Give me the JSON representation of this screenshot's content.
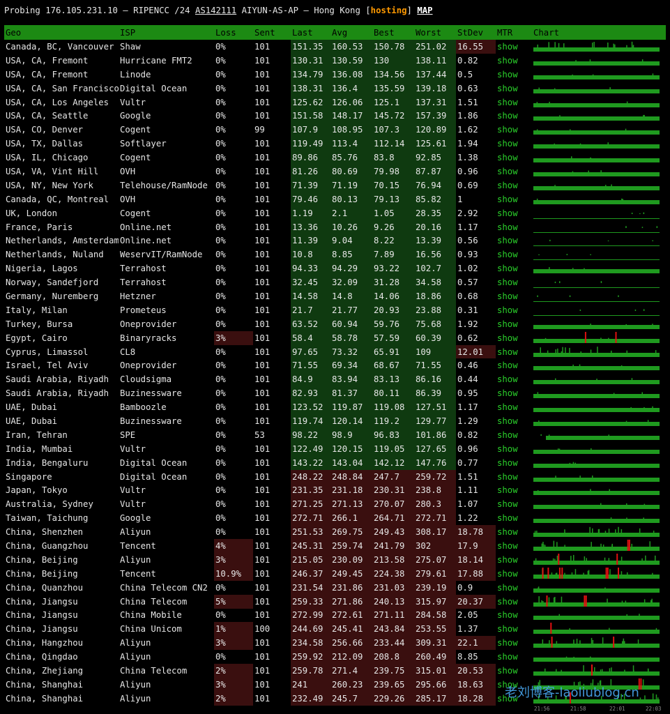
{
  "header": {
    "text_a": "Probing 176.105.231.10 – RIPENCC /24 ",
    "asn": "AS142111",
    "text_b": " AIYUN-AS-AP – Hong Kong ",
    "tag": "hosting",
    "map_link": "MAP"
  },
  "columns": [
    "Geo",
    "ISP",
    "Loss",
    "Sent",
    "Last",
    "Avg",
    "Best",
    "Worst",
    "StDev",
    "MTR",
    "Chart"
  ],
  "rows": [
    {
      "geo": "Canada, BC, Vancouver",
      "isp": "Shaw",
      "loss": "0%",
      "sent": "101",
      "last": "151.35",
      "avg": "160.53",
      "best": "150.78",
      "worst": "251.02",
      "stdev": "16.55",
      "mtr": "show"
    },
    {
      "geo": "USA, CA, Fremont",
      "isp": "Hurricane FMT2",
      "loss": "0%",
      "sent": "101",
      "last": "130.31",
      "avg": "130.59",
      "best": "130",
      "worst": "138.11",
      "stdev": "0.82",
      "mtr": "show"
    },
    {
      "geo": "USA, CA, Fremont",
      "isp": "Linode",
      "loss": "0%",
      "sent": "101",
      "last": "134.79",
      "avg": "136.08",
      "best": "134.56",
      "worst": "137.44",
      "stdev": "0.5",
      "mtr": "show"
    },
    {
      "geo": "USA, CA, San Francisco",
      "isp": "Digital Ocean",
      "loss": "0%",
      "sent": "101",
      "last": "138.31",
      "avg": "136.4",
      "best": "135.59",
      "worst": "139.18",
      "stdev": "0.63",
      "mtr": "show"
    },
    {
      "geo": "USA, CA, Los Angeles",
      "isp": "Vultr",
      "loss": "0%",
      "sent": "101",
      "last": "125.62",
      "avg": "126.06",
      "best": "125.1",
      "worst": "137.31",
      "stdev": "1.51",
      "mtr": "show"
    },
    {
      "geo": "USA, CA, Seattle",
      "isp": "Google",
      "loss": "0%",
      "sent": "101",
      "last": "151.58",
      "avg": "148.17",
      "best": "145.72",
      "worst": "157.39",
      "stdev": "1.86",
      "mtr": "show"
    },
    {
      "geo": "USA, CO, Denver",
      "isp": "Cogent",
      "loss": "0%",
      "sent": "99",
      "last": "107.9",
      "avg": "108.95",
      "best": "107.3",
      "worst": "120.89",
      "stdev": "1.62",
      "mtr": "show"
    },
    {
      "geo": "USA, TX, Dallas",
      "isp": "Softlayer",
      "loss": "0%",
      "sent": "101",
      "last": "119.49",
      "avg": "113.4",
      "best": "112.14",
      "worst": "125.61",
      "stdev": "1.94",
      "mtr": "show"
    },
    {
      "geo": "USA, IL, Chicago",
      "isp": "Cogent",
      "loss": "0%",
      "sent": "101",
      "last": "89.86",
      "avg": "85.76",
      "best": "83.8",
      "worst": "92.85",
      "stdev": "1.38",
      "mtr": "show"
    },
    {
      "geo": "USA, VA, Vint Hill",
      "isp": "OVH",
      "loss": "0%",
      "sent": "101",
      "last": "81.26",
      "avg": "80.69",
      "best": "79.98",
      "worst": "87.87",
      "stdev": "0.96",
      "mtr": "show"
    },
    {
      "geo": "USA, NY, New York",
      "isp": "Telehouse/RamNode",
      "loss": "0%",
      "sent": "101",
      "last": "71.39",
      "avg": "71.19",
      "best": "70.15",
      "worst": "76.94",
      "stdev": "0.69",
      "mtr": "show"
    },
    {
      "geo": "Canada, QC, Montreal",
      "isp": "OVH",
      "loss": "0%",
      "sent": "101",
      "last": "79.46",
      "avg": "80.13",
      "best": "79.13",
      "worst": "85.82",
      "stdev": "1",
      "mtr": "show"
    },
    {
      "geo": "UK, London",
      "isp": "Cogent",
      "loss": "0%",
      "sent": "101",
      "last": "1.19",
      "avg": "2.1",
      "best": "1.05",
      "worst": "28.35",
      "stdev": "2.92",
      "mtr": "show"
    },
    {
      "geo": "France, Paris",
      "isp": "Online.net",
      "loss": "0%",
      "sent": "101",
      "last": "13.36",
      "avg": "10.26",
      "best": "9.26",
      "worst": "20.16",
      "stdev": "1.17",
      "mtr": "show"
    },
    {
      "geo": "Netherlands, Amsterdam",
      "isp": "Online.net",
      "loss": "0%",
      "sent": "101",
      "last": "11.39",
      "avg": "9.04",
      "best": "8.22",
      "worst": "13.39",
      "stdev": "0.56",
      "mtr": "show"
    },
    {
      "geo": "Netherlands, Nuland",
      "isp": "WeservIT/RamNode",
      "loss": "0%",
      "sent": "101",
      "last": "10.8",
      "avg": "8.85",
      "best": "7.89",
      "worst": "16.56",
      "stdev": "0.93",
      "mtr": "show"
    },
    {
      "geo": "Nigeria, Lagos",
      "isp": "Terrahost",
      "loss": "0%",
      "sent": "101",
      "last": "94.33",
      "avg": "94.29",
      "best": "93.22",
      "worst": "102.7",
      "stdev": "1.02",
      "mtr": "show"
    },
    {
      "geo": "Norway, Sandefjord",
      "isp": "Terrahost",
      "loss": "0%",
      "sent": "101",
      "last": "32.45",
      "avg": "32.09",
      "best": "31.28",
      "worst": "34.58",
      "stdev": "0.57",
      "mtr": "show"
    },
    {
      "geo": "Germany, Nuremberg",
      "isp": "Hetzner",
      "loss": "0%",
      "sent": "101",
      "last": "14.58",
      "avg": "14.8",
      "best": "14.06",
      "worst": "18.86",
      "stdev": "0.68",
      "mtr": "show"
    },
    {
      "geo": "Italy, Milan",
      "isp": "Prometeus",
      "loss": "0%",
      "sent": "101",
      "last": "21.7",
      "avg": "21.77",
      "best": "20.93",
      "worst": "23.88",
      "stdev": "0.31",
      "mtr": "show"
    },
    {
      "geo": "Turkey, Bursa",
      "isp": "Oneprovider",
      "loss": "0%",
      "sent": "101",
      "last": "63.52",
      "avg": "60.94",
      "best": "59.76",
      "worst": "75.68",
      "stdev": "1.92",
      "mtr": "show"
    },
    {
      "geo": "Egypt, Cairo",
      "isp": "Binaryracks",
      "loss": "3%",
      "sent": "101",
      "last": "58.4",
      "avg": "58.78",
      "best": "57.59",
      "worst": "60.39",
      "stdev": "0.62",
      "mtr": "show"
    },
    {
      "geo": "Cyprus, Limassol",
      "isp": "CL8",
      "loss": "0%",
      "sent": "101",
      "last": "97.65",
      "avg": "73.32",
      "best": "65.91",
      "worst": "109",
      "stdev": "12.01",
      "mtr": "show"
    },
    {
      "geo": "Israel, Tel Aviv",
      "isp": "Oneprovider",
      "loss": "0%",
      "sent": "101",
      "last": "71.55",
      "avg": "69.34",
      "best": "68.67",
      "worst": "71.55",
      "stdev": "0.46",
      "mtr": "show"
    },
    {
      "geo": "Saudi Arabia, Riyadh",
      "isp": "Cloudsigma",
      "loss": "0%",
      "sent": "101",
      "last": "84.9",
      "avg": "83.94",
      "best": "83.13",
      "worst": "86.16",
      "stdev": "0.44",
      "mtr": "show"
    },
    {
      "geo": "Saudi Arabia, Riyadh",
      "isp": "Buzinessware",
      "loss": "0%",
      "sent": "101",
      "last": "82.93",
      "avg": "81.37",
      "best": "80.11",
      "worst": "86.39",
      "stdev": "0.95",
      "mtr": "show"
    },
    {
      "geo": "UAE, Dubai",
      "isp": "Bamboozle",
      "loss": "0%",
      "sent": "101",
      "last": "123.52",
      "avg": "119.87",
      "best": "119.08",
      "worst": "127.51",
      "stdev": "1.17",
      "mtr": "show"
    },
    {
      "geo": "UAE, Dubai",
      "isp": "Buzinessware",
      "loss": "0%",
      "sent": "101",
      "last": "119.74",
      "avg": "120.14",
      "best": "119.2",
      "worst": "129.77",
      "stdev": "1.29",
      "mtr": "show"
    },
    {
      "geo": "Iran, Tehran",
      "isp": "SPE",
      "loss": "0%",
      "sent": "53",
      "last": "98.22",
      "avg": "98.9",
      "best": "96.83",
      "worst": "101.86",
      "stdev": "0.82",
      "mtr": "show"
    },
    {
      "geo": "India, Mumbai",
      "isp": "Vultr",
      "loss": "0%",
      "sent": "101",
      "last": "122.49",
      "avg": "120.15",
      "best": "119.05",
      "worst": "127.65",
      "stdev": "0.96",
      "mtr": "show"
    },
    {
      "geo": "India, Bengaluru",
      "isp": "Digital Ocean",
      "loss": "0%",
      "sent": "101",
      "last": "143.22",
      "avg": "143.04",
      "best": "142.12",
      "worst": "147.76",
      "stdev": "0.77",
      "mtr": "show"
    },
    {
      "geo": "Singapore",
      "isp": "Digital Ocean",
      "loss": "0%",
      "sent": "101",
      "last": "248.22",
      "avg": "248.84",
      "best": "247.7",
      "worst": "259.72",
      "stdev": "1.51",
      "mtr": "show"
    },
    {
      "geo": "Japan, Tokyo",
      "isp": "Vultr",
      "loss": "0%",
      "sent": "101",
      "last": "231.35",
      "avg": "231.18",
      "best": "230.31",
      "worst": "238.8",
      "stdev": "1.11",
      "mtr": "show"
    },
    {
      "geo": "Australia, Sydney",
      "isp": "Vultr",
      "loss": "0%",
      "sent": "101",
      "last": "271.25",
      "avg": "271.13",
      "best": "270.07",
      "worst": "280.3",
      "stdev": "1.07",
      "mtr": "show"
    },
    {
      "geo": "Taiwan, Taichung",
      "isp": "Google",
      "loss": "0%",
      "sent": "101",
      "last": "272.71",
      "avg": "266.1",
      "best": "264.71",
      "worst": "272.71",
      "stdev": "1.22",
      "mtr": "show"
    },
    {
      "geo": "China, Shenzhen",
      "isp": "Aliyun",
      "loss": "0%",
      "sent": "101",
      "last": "251.53",
      "avg": "269.75",
      "best": "249.43",
      "worst": "308.17",
      "stdev": "18.78",
      "mtr": "show"
    },
    {
      "geo": "China, Guangzhou",
      "isp": "Tencent",
      "loss": "4%",
      "sent": "101",
      "last": "245.31",
      "avg": "259.74",
      "best": "241.79",
      "worst": "302",
      "stdev": "17.9",
      "mtr": "show"
    },
    {
      "geo": "China, Beijing",
      "isp": "Aliyun",
      "loss": "3%",
      "sent": "101",
      "last": "215.05",
      "avg": "230.09",
      "best": "213.58",
      "worst": "275.07",
      "stdev": "18.14",
      "mtr": "show"
    },
    {
      "geo": "China, Beijing",
      "isp": "Tencent",
      "loss": "10.9%",
      "sent": "101",
      "last": "246.37",
      "avg": "249.45",
      "best": "224.38",
      "worst": "279.61",
      "stdev": "17.88",
      "mtr": "show"
    },
    {
      "geo": "China, Quanzhou",
      "isp": "China Telecom CN2",
      "loss": "0%",
      "sent": "101",
      "last": "231.54",
      "avg": "231.86",
      "best": "231.03",
      "worst": "239.19",
      "stdev": "0.9",
      "mtr": "show"
    },
    {
      "geo": "China, Jiangsu",
      "isp": "China Telecom",
      "loss": "5%",
      "sent": "101",
      "last": "259.33",
      "avg": "271.86",
      "best": "240.13",
      "worst": "315.97",
      "stdev": "20.37",
      "mtr": "show"
    },
    {
      "geo": "China, Jiangsu",
      "isp": "China Mobile",
      "loss": "0%",
      "sent": "101",
      "last": "272.99",
      "avg": "272.61",
      "best": "271.11",
      "worst": "284.58",
      "stdev": "2.05",
      "mtr": "show"
    },
    {
      "geo": "China, Jiangsu",
      "isp": "China Unicom",
      "loss": "1%",
      "sent": "100",
      "last": "244.69",
      "avg": "245.41",
      "best": "243.84",
      "worst": "253.55",
      "stdev": "1.37",
      "mtr": "show"
    },
    {
      "geo": "China, Hangzhou",
      "isp": "Aliyun",
      "loss": "3%",
      "sent": "101",
      "last": "234.58",
      "avg": "256.66",
      "best": "233.44",
      "worst": "309.31",
      "stdev": "22.1",
      "mtr": "show"
    },
    {
      "geo": "China, Qingdao",
      "isp": "Aliyun",
      "loss": "0%",
      "sent": "101",
      "last": "259.92",
      "avg": "212.09",
      "best": "208.8",
      "worst": "260.49",
      "stdev": "8.85",
      "mtr": "show"
    },
    {
      "geo": "China, Zhejiang",
      "isp": "China Telecom",
      "loss": "2%",
      "sent": "101",
      "last": "259.78",
      "avg": "271.4",
      "best": "239.75",
      "worst": "315.01",
      "stdev": "20.53",
      "mtr": "show"
    },
    {
      "geo": "China, Shanghai",
      "isp": "Aliyun",
      "loss": "3%",
      "sent": "101",
      "last": "241",
      "avg": "260.23",
      "best": "239.65",
      "worst": "295.66",
      "stdev": "18.63",
      "mtr": "show"
    },
    {
      "geo": "China, Shanghai",
      "isp": "Aliyun",
      "loss": "2%",
      "sent": "101",
      "last": "232.49",
      "avg": "245.7",
      "best": "229.26",
      "worst": "285.17",
      "stdev": "18.28",
      "mtr": "show"
    }
  ],
  "chart_axis": [
    "21:56",
    "21:58",
    "22:01",
    "22:03"
  ],
  "watermark": "老刘博客-laoliublog.cn",
  "colors": {
    "header_bar": "#1c8a13",
    "good_cell": "#0f3a10",
    "bad_cell": "#3a0f0f",
    "chart_green": "#1f9a1f",
    "chart_red": "#e01010",
    "mtr_link": "#2bd12b",
    "tag": "#ff9900"
  }
}
